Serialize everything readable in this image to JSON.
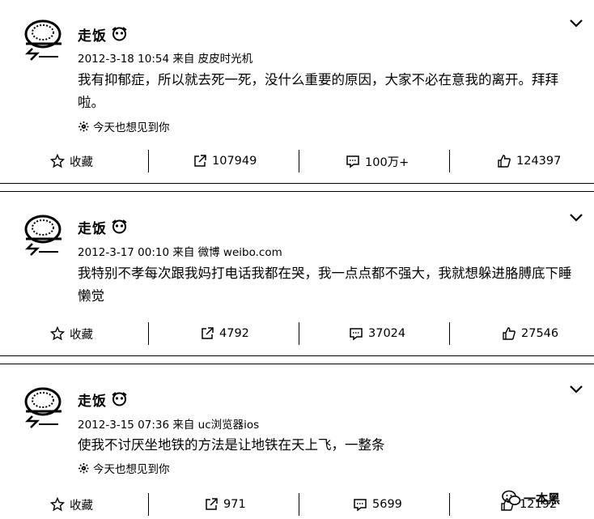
{
  "posts": [
    {
      "username": "走饭",
      "meta": "2012-3-18 10:54 来自 皮皮时光机",
      "text": "我有抑郁症，所以就去死一死，没什么重要的原因，大家不必在意我的离开。拜拜啦。",
      "tag": "今天也想见到你",
      "actions": {
        "favorite": "收藏",
        "repost": "107949",
        "comment": "100万+",
        "like": "124397"
      }
    },
    {
      "username": "走饭",
      "meta": "2012-3-17 00:10 来自 微博 weibo.com",
      "text": "我特别不孝每次跟我妈打电话我都在哭，我一点点都不强大，我就想躲进胳膊底下睡懒觉",
      "actions": {
        "favorite": "收藏",
        "repost": "4792",
        "comment": "37024",
        "like": "27546"
      }
    },
    {
      "username": "走饭",
      "meta": "2012-3-15 07:36 来自 uc浏览器ios",
      "text": "使我不讨厌坐地铁的方法是让地铁在天上飞，一整条",
      "tag": "今天也想见到你",
      "actions": {
        "favorite": "收藏",
        "repost": "971",
        "comment": "5699",
        "like": "12192"
      }
    }
  ],
  "watermark": "一本黑",
  "icons": {
    "favorite": "star-icon",
    "repost": "share-arrow-icon",
    "comment": "comment-icon",
    "like": "thumbs-up-icon",
    "more": "chevron-down-icon",
    "badge": "vip-badge-icon",
    "tag": "sparkle-icon"
  }
}
